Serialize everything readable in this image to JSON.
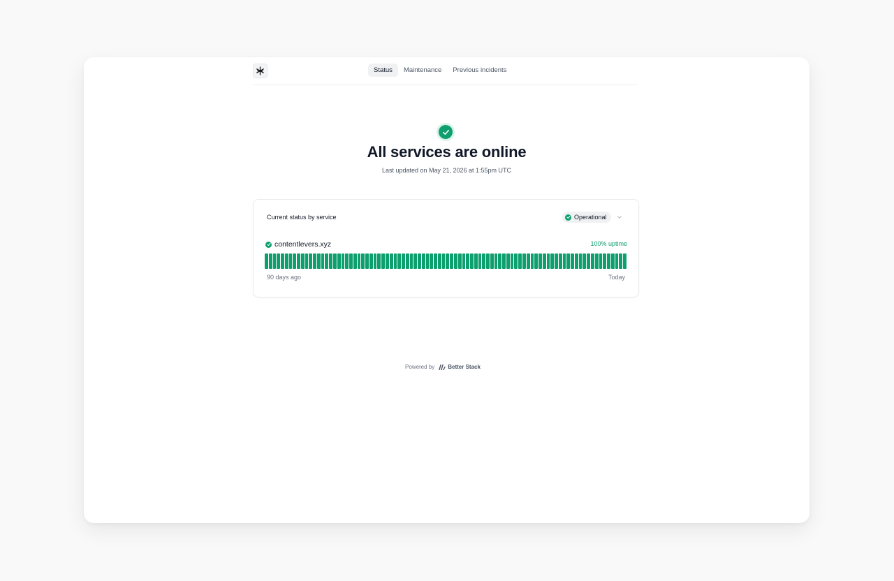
{
  "nav": {
    "logo_icon": "asterisk-logo-icon",
    "tabs": [
      {
        "label": "Status",
        "active": true
      },
      {
        "label": "Maintenance",
        "active": false
      },
      {
        "label": "Previous incidents",
        "active": false
      }
    ]
  },
  "hero": {
    "icon": "check-circle-icon",
    "title": "All services are online",
    "updated": "Last updated on May 21, 2026 at 1:55pm UTC"
  },
  "status_card": {
    "title": "Current status by service",
    "status_label": "Operational",
    "service": {
      "name": "contentlevers.xyz",
      "uptime": "100% uptime",
      "day_count": 90,
      "range_start": "90 days ago",
      "range_end": "Today"
    }
  },
  "footer": {
    "powered_by": "Powered by",
    "brand": "Better Stack"
  },
  "colors": {
    "success": "#0e9f6e",
    "success_light": "#d9f2e6",
    "background": "#f9f9f9"
  }
}
